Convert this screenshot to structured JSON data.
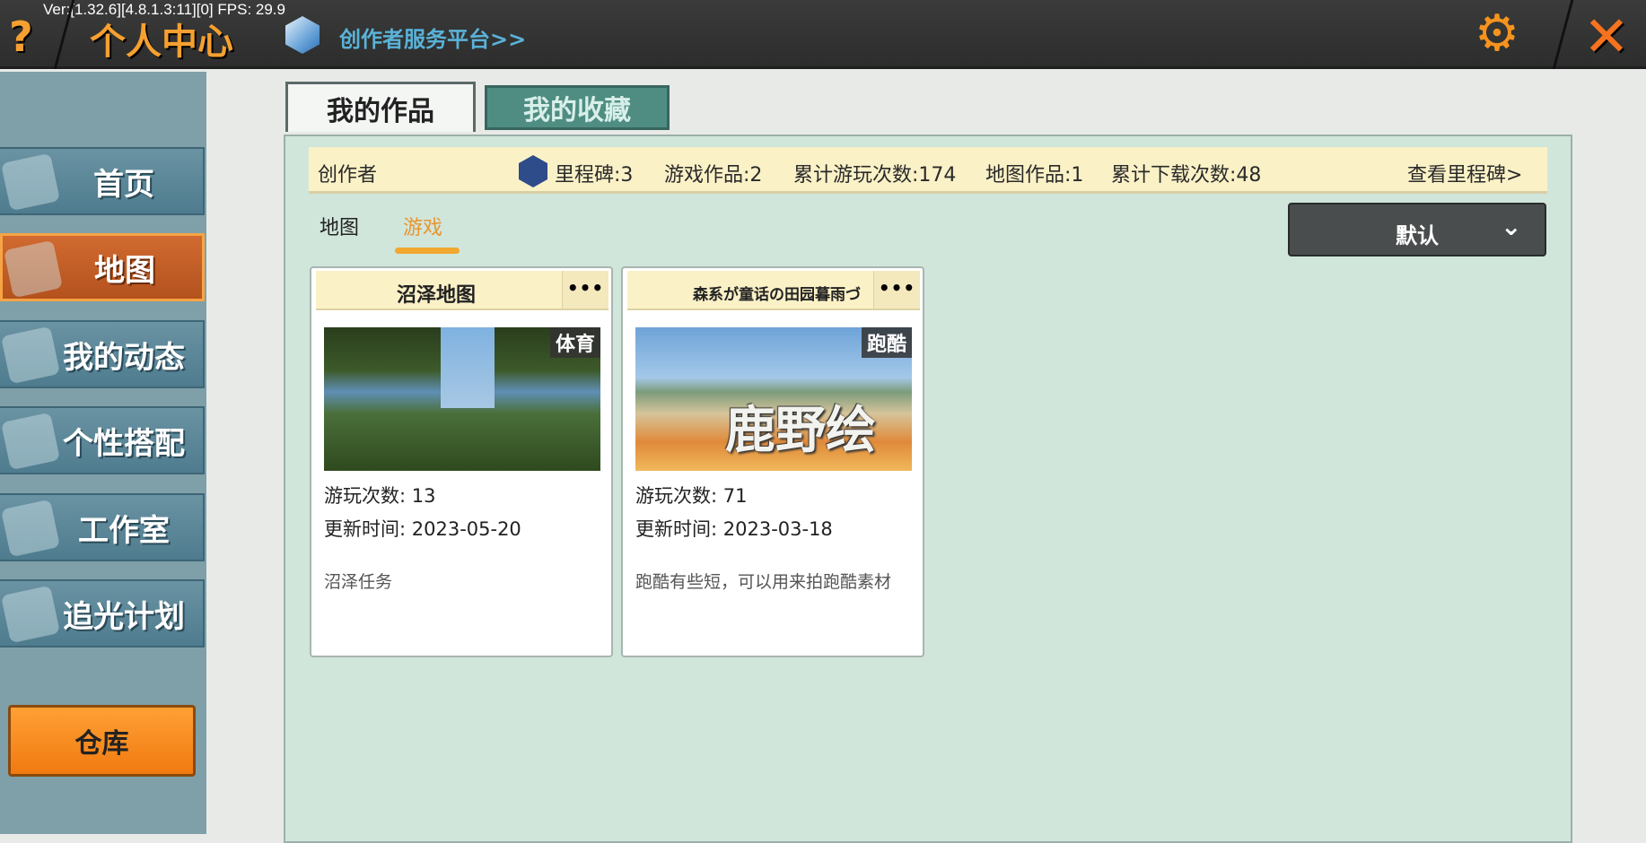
{
  "topbar": {
    "version": "Ver:[1.32.6][4.8.1.3:11][0] FPS: 29.9",
    "help": "?",
    "title": "个人中心",
    "platform_link": "创作者服务平台>>",
    "gear_icon": "gear-icon",
    "close_icon": "close-icon"
  },
  "sidebar": {
    "items": [
      {
        "label": "首页",
        "icon": "house-icon"
      },
      {
        "label": "地图",
        "icon": "picture-icon",
        "active": true
      },
      {
        "label": "我的动态",
        "icon": "bell-icon"
      },
      {
        "label": "个性搭配",
        "icon": "avatar-icon"
      },
      {
        "label": "工作室",
        "icon": "tree-icon"
      },
      {
        "label": "追光计划",
        "icon": "plan-icon"
      }
    ],
    "warehouse": "仓库"
  },
  "tabs": [
    {
      "label": "我的作品",
      "active": true
    },
    {
      "label": "我的收藏"
    }
  ],
  "info": {
    "role": "创作者",
    "milestones": "里程碑:3",
    "game_works": "游戏作品:2",
    "total_plays": "累计游玩次数:174",
    "map_works": "地图作品:1",
    "total_downloads": "累计下载次数:48",
    "view_milestones": "查看里程碑>"
  },
  "subtabs": [
    {
      "label": "地图"
    },
    {
      "label": "游戏",
      "active": true
    }
  ],
  "sort": {
    "value": "默认"
  },
  "colors": {
    "accent": "#f0a830",
    "active_sidebar": "#c2602a"
  },
  "cards": [
    {
      "title": "沼泽地图",
      "more": "•••",
      "tag": "体育",
      "plays": "游玩次数: 13",
      "updated": "更新时间: 2023-05-20",
      "desc": "沼泽任务"
    },
    {
      "title": "森系が童话の田园暮雨づ",
      "more": "•••",
      "tag": "跑酷",
      "overlay": "鹿野绘",
      "plays": "游玩次数: 71",
      "updated": "更新时间: 2023-03-18",
      "desc": "跑酷有些短，可以用来拍跑酷素材"
    }
  ]
}
